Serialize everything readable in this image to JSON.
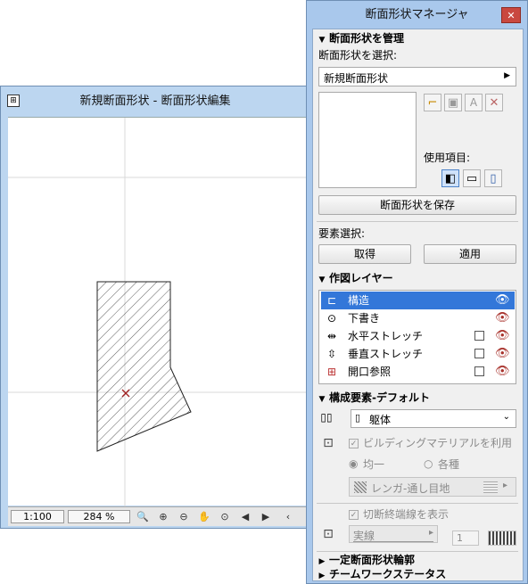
{
  "editor": {
    "title": "新規断面形状 - 断面形状編集",
    "scale": "1:100",
    "zoom": "284 %"
  },
  "palette": {
    "title": "断面形状マネージャ",
    "manage_header": "断面形状を管理",
    "select_label": "断面形状を選択:",
    "selected_profile": "新規断面形状",
    "usage_label": "使用項目:",
    "save_button": "断面形状を保存",
    "element_select_label": "要素選択:",
    "get_button": "取得",
    "apply_button": "適用",
    "layers_header": "作図レイヤー",
    "layers": [
      {
        "name": "構造",
        "icon": "structure-icon",
        "checkbox": false
      },
      {
        "name": "下書き",
        "icon": "draft-icon",
        "checkbox": false
      },
      {
        "name": "水平ストレッチ",
        "icon": "horizontal-stretch-icon",
        "checkbox": true
      },
      {
        "name": "垂直ストレッチ",
        "icon": "vertical-stretch-icon",
        "checkbox": true
      },
      {
        "name": "開口参照",
        "icon": "opening-reference-icon",
        "checkbox": true
      }
    ],
    "defaults_header": "構成要素-デフォルト",
    "component_type": "躯体",
    "use_building_material": "ビルディングマテリアルを利用",
    "radio_uniform": "均一",
    "radio_various": "各種",
    "material": "レンガ-通し目地",
    "show_cut_lines": "切断終端線を表示",
    "line_type": "実線",
    "pen_number": "1",
    "constant_profile_header": "一定断面形状輪郭",
    "teamwork_header": "チームワークステータス"
  }
}
